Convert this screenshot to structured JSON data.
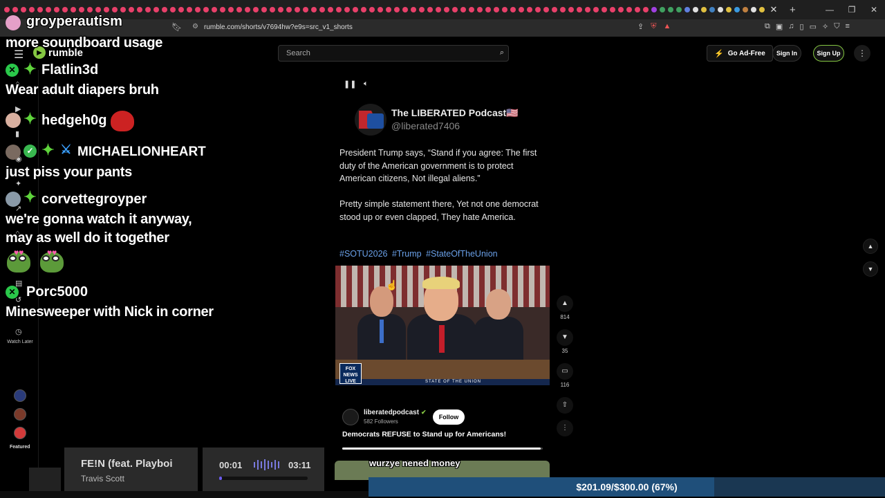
{
  "browser": {
    "url": "rumble.com/shorts/v7694hw?e9s=src_v1_shorts",
    "tab_close": "✕",
    "new_tab": "+"
  },
  "header": {
    "logo_text": "rumble",
    "search_placeholder": "Search",
    "ad_free_label": "Go Ad-Free",
    "sign_in_label": "Sign In",
    "sign_up_label": "Sign Up",
    "accent_color": "#85c742"
  },
  "sidebar": {
    "watch_later_label": "Watch Later",
    "featured_label": "Featured"
  },
  "chat": {
    "messages": [
      {
        "user": "groyperautism",
        "text": "more soundboard usage",
        "color": "#d98ce0"
      },
      {
        "user": "Flatlin3d",
        "text": "Wear adult diapers bruh",
        "color": "#7ed957"
      },
      {
        "user": "hedgeh0g",
        "text": "",
        "color": "#ffffff"
      },
      {
        "user": "MICHAELIONHEART",
        "text": "just piss your pants",
        "color": "#7fe0d0"
      },
      {
        "user": "corvettegroyper",
        "text": "we're gonna watch it anyway,",
        "text2": "may as well do it together",
        "color": "#9fd66a"
      },
      {
        "user": "Porc5000",
        "text": "Minesweeper with Nick in corner",
        "color": "#f07070"
      }
    ]
  },
  "post": {
    "channel_name": "The LIBERATED Podcast🇺🇸",
    "channel_handle": "@liberated7406",
    "paragraph1": "President Trump says, “Stand if you agree: The first duty of the American government is to protect American citizens, Not illegal aliens.”",
    "paragraph2": "Pretty simple statement there, Yet not one democrat stood up or even clapped, They hate America.",
    "hashtags": [
      "#SOTU2026",
      "#Trump",
      "#StateOfTheUnion"
    ],
    "fox_logo": "FOX NEWS LIVE",
    "sotu_banner": "STATE OF THE UNION",
    "likes": "814",
    "dislikes": "35",
    "comments": "116",
    "owner_name": "liberatedpodcast",
    "owner_followers": "582 Followers",
    "follow_label": "Follow",
    "video_title": "Democrats REFUSE to Stand up for Americans!",
    "progress": 0.99,
    "next_caption": "wurzye nened money"
  },
  "music": {
    "song": "FE!N (feat. Playboi",
    "artist": "Travis Scott",
    "current_time": "00:01",
    "total_time": "03:11",
    "progress": 0.01
  },
  "goal": {
    "text": "$201.09/$300.00 (67%)",
    "fraction": 0.67
  }
}
